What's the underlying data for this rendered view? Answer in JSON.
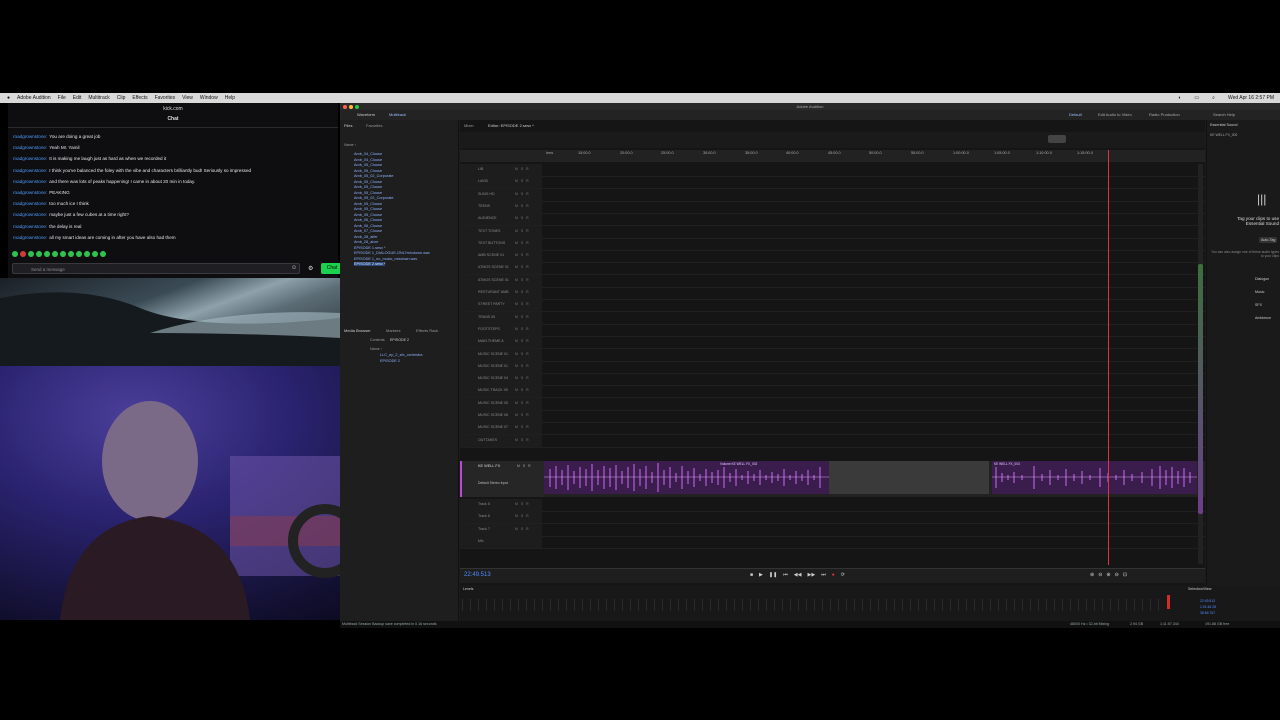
{
  "menubar": {
    "items": [
      "Adobe Audition",
      "File",
      "Edit",
      "Multitrack",
      "Clip",
      "Effects",
      "Favorites",
      "View",
      "Window",
      "Help"
    ],
    "clock": "Wed Apr 16  2:57 PM"
  },
  "chat": {
    "site": "kick.com",
    "title": "Chat",
    "messages": [
      {
        "user": "roadgrownstone:",
        "text": "You are doing a great job"
      },
      {
        "user": "roadgrownstone:",
        "text": "Yeah Mr. Yamil"
      },
      {
        "user": "roadgrownstone:",
        "text": "It is making me laugh just as hard as when we recorded it"
      },
      {
        "user": "roadgrownstone:",
        "text": "I think you've balanced the foley with the vibe and characters brilliantly bud! Seriously so impressed"
      },
      {
        "user": "roadgrownstone:",
        "text": "and there was lots of peaks happening! I came in about 20 min in today."
      },
      {
        "user": "roadgrownstone:",
        "text": "PEAKING"
      },
      {
        "user": "roadgrownstone:",
        "text": "too much ice I think"
      },
      {
        "user": "roadgrownstone:",
        "text": "maybe just a few cubes at a time right?"
      },
      {
        "user": "roadgrownstone:",
        "text": "the delay is real"
      },
      {
        "user": "roadgrownstone:",
        "text": "all my smart ideas are coming in after you have also had them"
      }
    ],
    "input_placeholder": "Send a message",
    "send_label": "Chat"
  },
  "audition": {
    "window_title": "Adobe Audition",
    "tabs": {
      "waveform": "Waveform",
      "multitrack": "Multitrack"
    },
    "workspace_tabs": [
      "Default",
      "Edit Audio to Video",
      "Radio Production"
    ],
    "search_placeholder": "Search Help",
    "files_panel": {
      "tabs": [
        "Files",
        "Favorites"
      ],
      "name_header": "Name ↑",
      "files": [
        "Amb_04_Clouse",
        "Amb_04_Clouse",
        "Amb_05_Clouse",
        "Amb_05_Clouse",
        "Amb_05_02_Corporate",
        "Amb_05_Clouse",
        "Amb_05_Clouse",
        "Amb_05_Clouse",
        "Amb_05_02_Corporate",
        "Amb_05_Clouse",
        "Amb_05_Clouse",
        "Amb_05_Clouse",
        "Amb_06_Clouse",
        "Amb_06_Clouse",
        "Amb_07_Clouse",
        "Amb_28_aifer",
        "Amb_28_aiver",
        "EPISODE 1.sesx *",
        "EPISODE 1_DIALOGUE-ONLYmixdown.wav",
        "EPISODE 1_no_music_mixdown.wav",
        "EPISODE 2.sesx *"
      ]
    },
    "media_panel": {
      "tabs": [
        "Media Browser",
        "Markers",
        "Effects Rack"
      ],
      "contents_label": "Contents:",
      "contents_value": "EPISODE 2",
      "name_header": "Name ↑",
      "items": [
        "LLC_ep_2_sfx_orchestra",
        "EPISODE 2"
      ]
    },
    "editor": {
      "tab": "Editor: EPISODE 2.sesx *",
      "mixer_tab": "Mixer",
      "ruler": [
        "hms",
        "15:00.0",
        "20:00.0",
        "25:00.0",
        "30:00.0",
        "35:00.0",
        "40:00.0",
        "45:00.0",
        "50:00.0",
        "55:00.0",
        "1:00:00.0",
        "1:05:00.0",
        "1:10:00.0",
        "1:15:00.0"
      ],
      "tracks": [
        "LIB",
        "LAVID",
        "SUNG HD",
        "TEENS",
        "AUDIENCE",
        "TEXT TONES",
        "TEXT BUTTONS",
        "AMB SCENE 01",
        "ATMOS SCENE 01",
        "ATMOS SCENE 01",
        "RESTURANT AMB",
        "STREET PARTY",
        "TRANS 05",
        "FOOTSTEPS",
        "MAIN THEME A",
        "MUSIC SCENE 01",
        "MUSIC SCENE 01",
        "MUSIC SCENE 04",
        "MUSIC TRACK 05",
        "MUSIC SCENE 05",
        "MUSIC SCENE 06",
        "MUSIC SCENE 07",
        "OUTTAKES"
      ],
      "active_track": {
        "name": "KE WELL FX",
        "input": "Default Stereo Input",
        "clip1": "Volume  KE WELL FX_002",
        "clip2": "KE WELL FX_003"
      },
      "bottom_tracks": [
        "Track 5",
        "Track 6",
        "Track 7"
      ],
      "master": "Mix",
      "timecode": "22:49.513"
    },
    "right_panel": {
      "title": "Essential Sound",
      "subtitle": "KE WELL FX_002",
      "tag_heading": "Tag your clips to use Essential Sound",
      "autotag": "Auto-Tag",
      "hint": "You can also assign one of these audio types to your clips",
      "types": [
        "Dialogue",
        "Music",
        "SFX",
        "Ambience"
      ]
    },
    "levels_label": "Levels",
    "selection_label": "Selection/View",
    "selection": {
      "start": "22:49.513",
      "end": "1:01:46.28",
      "duration": "38:56.767"
    },
    "status": "Multitrack Session Backup save completed in 0.16 seconds",
    "status_right": [
      "48000 Hz • 32-bit Mixing",
      "2.94 GB",
      "1:11:57.344",
      "191.88 GB free"
    ]
  }
}
